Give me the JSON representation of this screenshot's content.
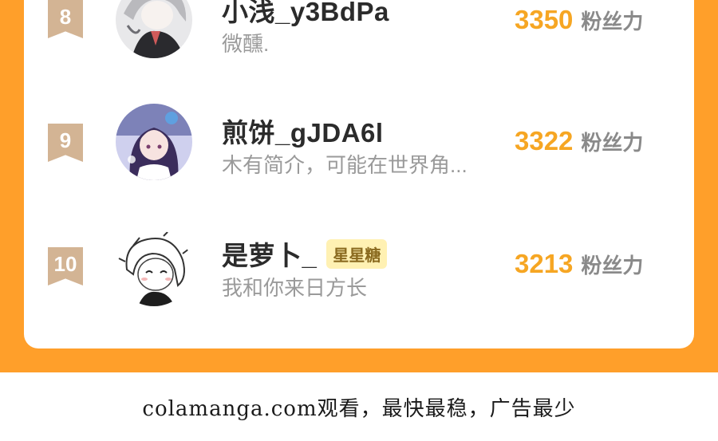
{
  "ranking": [
    {
      "rank": "8",
      "name": "小浅_y3BdPa",
      "badge": "",
      "bio": "微醺.",
      "score": "3350",
      "unit": "粉丝力"
    },
    {
      "rank": "9",
      "name": "煎饼_gJDA6l",
      "badge": "",
      "bio": "木有简介，可能在世界角...",
      "score": "3322",
      "unit": "粉丝力"
    },
    {
      "rank": "10",
      "name": "是萝卜_",
      "badge": "星星糖",
      "bio": "我和你来日方长",
      "score": "3213",
      "unit": "粉丝力"
    }
  ],
  "footer": {
    "watermark": "colamanga.com观看，最快最稳，广告最少"
  },
  "colors": {
    "frame": "#FF9F2A",
    "score": "#F6A623",
    "rank_ribbon": "#D3B494",
    "badge_bg": "#FFF1B3"
  }
}
